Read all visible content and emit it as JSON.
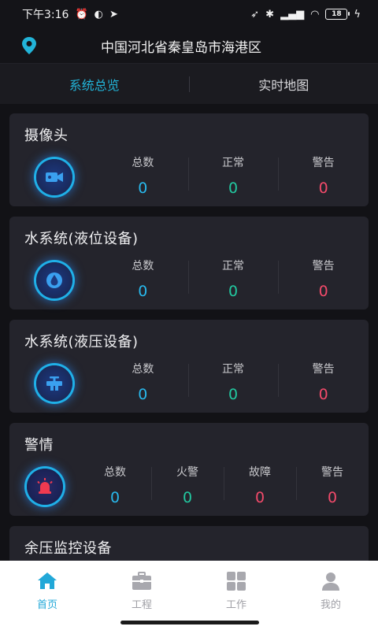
{
  "status_bar": {
    "time": "下午3:16",
    "battery": "18"
  },
  "location": {
    "address": "中国河北省秦皇岛市海港区"
  },
  "tabs": [
    {
      "label": "系统总览",
      "active": true
    },
    {
      "label": "实时地图",
      "active": false
    }
  ],
  "cards": {
    "camera": {
      "title": "摄像头",
      "stats": [
        {
          "label": "总数",
          "value": "0"
        },
        {
          "label": "正常",
          "value": "0"
        },
        {
          "label": "警告",
          "value": "0"
        }
      ]
    },
    "water_level": {
      "title": "水系统(液位设备)",
      "stats": [
        {
          "label": "总数",
          "value": "0"
        },
        {
          "label": "正常",
          "value": "0"
        },
        {
          "label": "警告",
          "value": "0"
        }
      ]
    },
    "water_pressure": {
      "title": "水系统(液压设备)",
      "stats": [
        {
          "label": "总数",
          "value": "0"
        },
        {
          "label": "正常",
          "value": "0"
        },
        {
          "label": "警告",
          "value": "0"
        }
      ]
    },
    "alarm": {
      "title": "警情",
      "stats": [
        {
          "label": "总数",
          "value": "0"
        },
        {
          "label": "火警",
          "value": "0"
        },
        {
          "label": "故障",
          "value": "0"
        },
        {
          "label": "警告",
          "value": "0"
        }
      ]
    },
    "residual_pressure": {
      "title": "余压监控设备"
    }
  },
  "bottom_nav": [
    {
      "label": "首页",
      "icon": "home-icon",
      "active": true
    },
    {
      "label": "工程",
      "icon": "briefcase-icon",
      "active": false
    },
    {
      "label": "工作",
      "icon": "grid-icon",
      "active": false
    },
    {
      "label": "我的",
      "icon": "user-icon",
      "active": false
    }
  ],
  "colors": {
    "accent": "#22b4d8",
    "total": "#28b8ec",
    "normal": "#22c8a0",
    "warning": "#f24a6a"
  }
}
